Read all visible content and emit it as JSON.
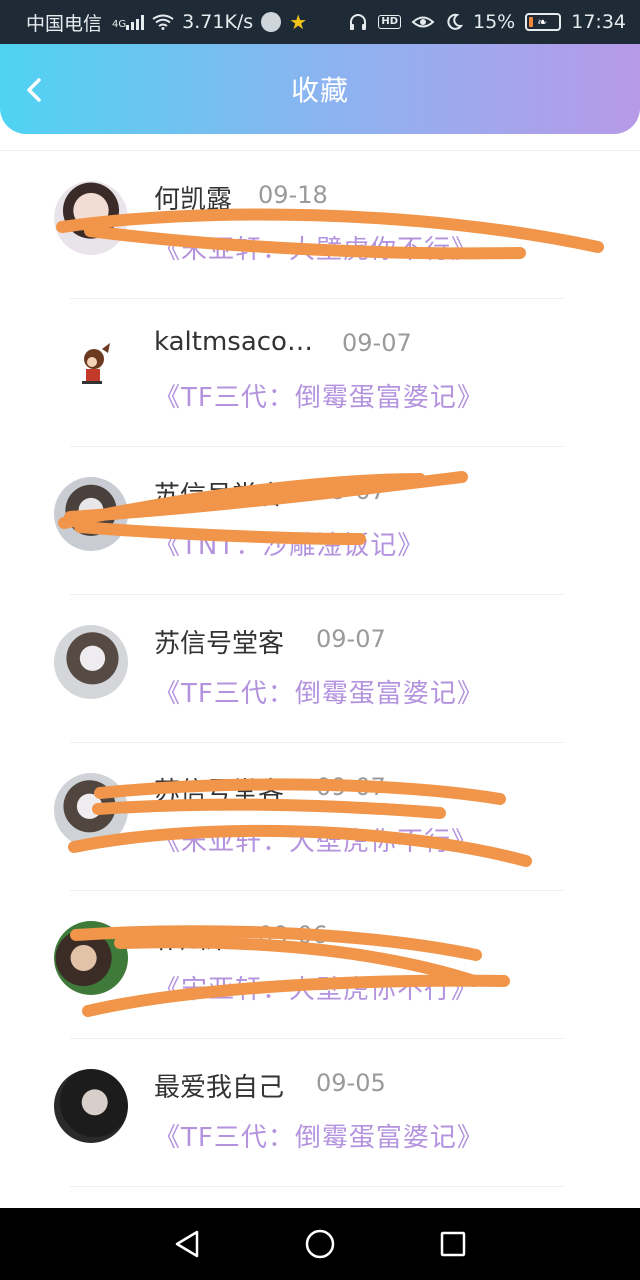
{
  "status_bar": {
    "carrier": "中国电信",
    "network": "4G",
    "speed": "3.71K/s",
    "battery": "15%",
    "battery_level": 0.15,
    "time": "17:34",
    "hd": "HD"
  },
  "header": {
    "title": "收藏",
    "back_icon": "chevron-left-icon"
  },
  "favorites": [
    {
      "name": "何凯露",
      "date": "09-18",
      "book": "《宋亚轩：大壁虎你不行》"
    },
    {
      "name": "kaltmsaco…",
      "date": "09-07",
      "book": "《TF三代：倒霉蛋富婆记》"
    },
    {
      "name": "苏信号堂客",
      "date": "09-07",
      "book": "《TNT：沙雕淦饭记》"
    },
    {
      "name": "苏信号堂客",
      "date": "09-07",
      "book": "《TF三代：倒霉蛋富婆记》"
    },
    {
      "name": "苏信号堂客",
      "date": "09-07",
      "book": "《宋亚轩：大壁虎你不行》"
    },
    {
      "name": "朴灿果",
      "date": "09-06",
      "book": "《宋亚轩：大壁虎你不行》"
    },
    {
      "name": "最爱我自己",
      "date": "09-05",
      "book": "《TF三代：倒霉蛋富婆记》"
    }
  ],
  "colors": {
    "header_gradient_start": "#4fd3f2",
    "header_gradient_end": "#b79ae8",
    "book_title": "#b493de",
    "scribble": "#f0954a"
  },
  "nav": {
    "back": "triangle-back-icon",
    "home": "circle-home-icon",
    "recents": "square-recents-icon"
  }
}
